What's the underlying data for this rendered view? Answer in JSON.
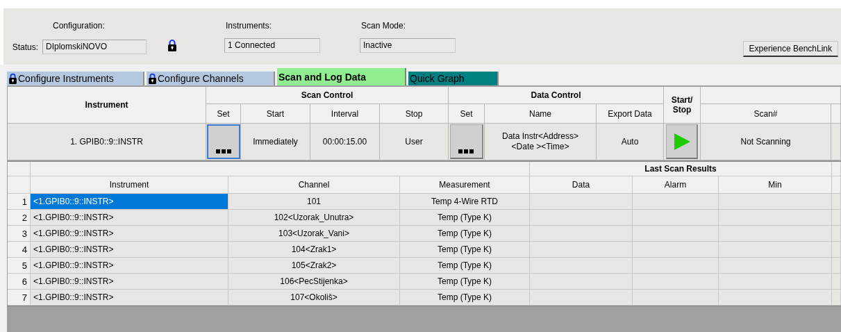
{
  "header": {
    "configuration_label": "Configuration:",
    "status_label": "Status:",
    "status_value": "DIplomskiNOVO",
    "status_locked": true,
    "instruments_label": "Instruments:",
    "instruments_value": "1 Connected",
    "scan_mode_label": "Scan Mode:",
    "scan_mode_value": "Inactive",
    "benchlink_button": "Experience BenchLink"
  },
  "tabs": [
    {
      "label": "Configure Instruments",
      "locked": true,
      "selected": false,
      "color": "#b4c8e0"
    },
    {
      "label": "Configure Channels",
      "locked": true,
      "selected": false,
      "color": "#b4c8e0"
    },
    {
      "label": "Scan and Log Data",
      "locked": false,
      "selected": true,
      "color": "#90ee90"
    },
    {
      "label": "Quick Graph",
      "locked": false,
      "selected": false,
      "color": "#008080"
    }
  ],
  "scan_table": {
    "instrument_header": "Instrument",
    "scan_control_header": "Scan Control",
    "data_control_header": "Data Control",
    "start_stop_header": "Start/\nStop",
    "columns": [
      "Set",
      "Start",
      "Interval",
      "Stop",
      "Set",
      "Name",
      "Export Data",
      "Scan#"
    ],
    "row": {
      "instrument": "1. GPIB0::9::INSTR",
      "start": "Immediately",
      "interval": "00:00:15.00",
      "stop": "User",
      "name": "Data Instr<Address>\n<Date ><Time>",
      "export": "Auto",
      "scan_number": "Not Scanning"
    }
  },
  "results_table": {
    "group_header": "Last Scan Results",
    "columns": [
      "Instrument",
      "Channel",
      "Measurement",
      "Data",
      "Alarm",
      "Min"
    ],
    "rows": [
      {
        "number": "1",
        "instrument": "<1.GPIB0::9::INSTR>",
        "channel": "101",
        "measurement": "Temp 4-Wire RTD",
        "selected": true
      },
      {
        "number": "2",
        "instrument": "<1.GPIB0::9::INSTR>",
        "channel": "102<Uzorak_Unutra>",
        "measurement": "Temp (Type K)",
        "selected": false
      },
      {
        "number": "3",
        "instrument": "<1.GPIB0::9::INSTR>",
        "channel": "103<Uzorak_Vani>",
        "measurement": "Temp (Type K)",
        "selected": false
      },
      {
        "number": "4",
        "instrument": "<1.GPIB0::9::INSTR>",
        "channel": "104<Zrak1>",
        "measurement": "Temp (Type K)",
        "selected": false
      },
      {
        "number": "5",
        "instrument": "<1.GPIB0::9::INSTR>",
        "channel": "105<Zrak2>",
        "measurement": "Temp (Type K)",
        "selected": false
      },
      {
        "number": "6",
        "instrument": "<1.GPIB0::9::INSTR>",
        "channel": "106<PecStijenka>",
        "measurement": "Temp (Type K)",
        "selected": false
      },
      {
        "number": "7",
        "instrument": "<1.GPIB0::9::INSTR>",
        "channel": "107<Okoliš>",
        "measurement": "Temp (Type K)",
        "selected": false
      }
    ]
  }
}
